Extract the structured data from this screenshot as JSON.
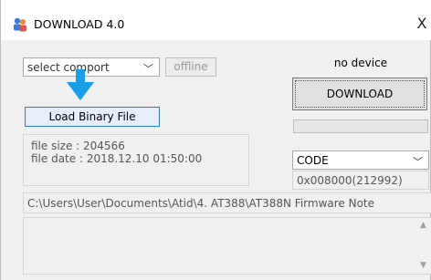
{
  "window": {
    "title": "DOWNLOAD 4.0",
    "close_symbol": "X",
    "app_icon": "people-icon"
  },
  "port": {
    "selected": "select comport",
    "offline_label": "offline"
  },
  "load_button_label": "Load Binary File",
  "file_info": {
    "size": "file size : 204566",
    "date": "file date : 2018.12.10 01:50:00"
  },
  "device": {
    "status": "no device",
    "download_label": "DOWNLOAD",
    "progress": 0
  },
  "target": {
    "selected": "CODE",
    "address": "0x008000(212992)"
  },
  "path": "C:\\Users\\User\\Documents\\Atid\\4. AT388\\AT388N Firmware Note",
  "colors": {
    "accent": "#2f7ad8",
    "arrow": "#1a9ee6"
  }
}
